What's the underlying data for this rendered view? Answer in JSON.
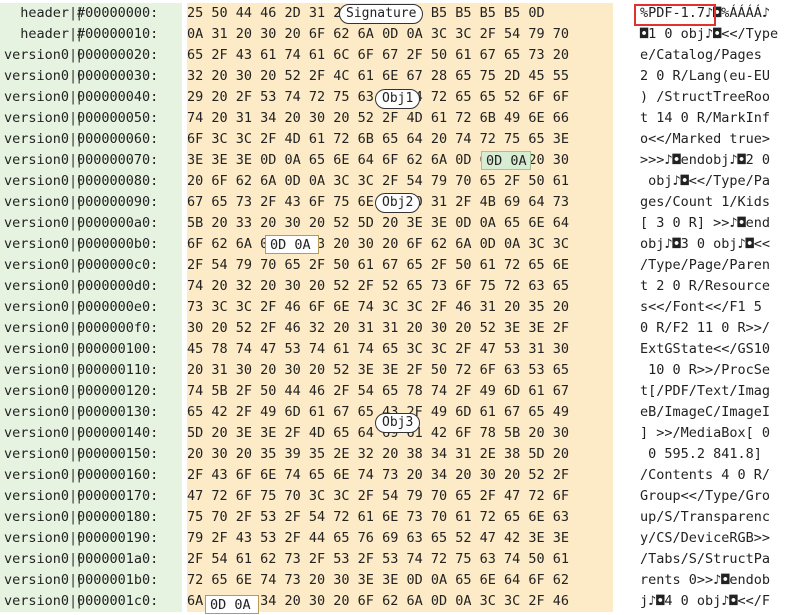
{
  "rows": [
    {
      "label": "header",
      "offset": "#00000000:",
      "hex": "25 50 44 46 2D 31 2E 37 0A 25 B5 B5 B5 B5 0D",
      "ascii": "%PDF-1.7♪◘%ÁÁÁÁ♪"
    },
    {
      "label": "header",
      "offset": "#00000010:",
      "hex": "0A 31 20 30 20 6F 62 6A 0D 0A 3C 3C 2F 54 79 70",
      "ascii": "◘1 0 obj♪◘<</Type"
    },
    {
      "label": "version0",
      "offset": "000000020:",
      "hex": "65 2F 43 61 74 61 6C 6F 67 2F 50 61 67 65 73 20",
      "ascii": "e/Catalog/Pages "
    },
    {
      "label": "version0",
      "offset": "000000030:",
      "hex": "32 20 30 20 52 2F 4C 61 6E 67 28 65 75 2D 45 55",
      "ascii": "2 0 R/Lang(eu-EU"
    },
    {
      "label": "version0",
      "offset": "000000040:",
      "hex": "29 20 2F 53 74 72 75 63 74 54 72 65 65 52 6F 6F",
      "ascii": ") /StructTreeRoo"
    },
    {
      "label": "version0",
      "offset": "000000050:",
      "hex": "74 20 31 34 20 30 20 52 2F 4D 61 72 6B 49 6E 66",
      "ascii": "t 14 0 R/MarkInf"
    },
    {
      "label": "version0",
      "offset": "000000060:",
      "hex": "6F 3C 3C 2F 4D 61 72 6B 65 64 20 74 72 75 65 3E",
      "ascii": "o<</Marked true>"
    },
    {
      "label": "version0",
      "offset": "000000070:",
      "hex": "3E 3E 3E 0D 0A 65 6E 64 6F 62 6A 0D 0A 32 20 30",
      "ascii": ">>>♪◘endobj♪◘2 0"
    },
    {
      "label": "version0",
      "offset": "000000080:",
      "hex": "20 6F 62 6A 0D 0A 3C 3C 2F 54 79 70 65 2F 50 61",
      "ascii": " obj♪◘<</Type/Pa"
    },
    {
      "label": "version0",
      "offset": "000000090:",
      "hex": "67 65 73 2F 43 6F 75 6E 74 20 31 2F 4B 69 64 73",
      "ascii": "ges/Count 1/Kids"
    },
    {
      "label": "version0",
      "offset": "0000000a0:",
      "hex": "5B 20 33 20 30 20 52 5D 20 3E 3E 0D 0A 65 6E 64",
      "ascii": "[ 3 0 R] >>♪◘end"
    },
    {
      "label": "version0",
      "offset": "0000000b0:",
      "hex": "6F 62 6A 0D 0A 33 20 30 20 6F 62 6A 0D 0A 3C 3C",
      "ascii": "obj♪◘3 0 obj♪◘<<"
    },
    {
      "label": "version0",
      "offset": "0000000c0:",
      "hex": "2F 54 79 70 65 2F 50 61 67 65 2F 50 61 72 65 6E",
      "ascii": "/Type/Page/Paren"
    },
    {
      "label": "version0",
      "offset": "0000000d0:",
      "hex": "74 20 32 20 30 20 52 2F 52 65 73 6F 75 72 63 65",
      "ascii": "t 2 0 R/Resource"
    },
    {
      "label": "version0",
      "offset": "0000000e0:",
      "hex": "73 3C 3C 2F 46 6F 6E 74 3C 3C 2F 46 31 20 35 20",
      "ascii": "s<</Font<</F1 5 "
    },
    {
      "label": "version0",
      "offset": "0000000f0:",
      "hex": "30 20 52 2F 46 32 20 31 31 20 30 20 52 3E 3E 2F",
      "ascii": "0 R/F2 11 0 R>>/"
    },
    {
      "label": "version0",
      "offset": "000000100:",
      "hex": "45 78 74 47 53 74 61 74 65 3C 3C 2F 47 53 31 30",
      "ascii": "ExtGState<</GS10"
    },
    {
      "label": "version0",
      "offset": "000000110:",
      "hex": "20 31 30 20 30 20 52 3E 3E 2F 50 72 6F 63 53 65",
      "ascii": " 10 0 R>>/ProcSe"
    },
    {
      "label": "version0",
      "offset": "000000120:",
      "hex": "74 5B 2F 50 44 46 2F 54 65 78 74 2F 49 6D 61 67",
      "ascii": "t[/PDF/Text/Imag"
    },
    {
      "label": "version0",
      "offset": "000000130:",
      "hex": "65 42 2F 49 6D 61 67 65 43 2F 49 6D 61 67 65 49",
      "ascii": "eB/ImageC/ImageI"
    },
    {
      "label": "version0",
      "offset": "000000140:",
      "hex": "5D 20 3E 3E 2F 4D 65 64 69 61 42 6F 78 5B 20 30",
      "ascii": "] >>/MediaBox[ 0"
    },
    {
      "label": "version0",
      "offset": "000000150:",
      "hex": "20 30 20 35 39 35 2E 32 20 38 34 31 2E 38 5D 20",
      "ascii": " 0 595.2 841.8] "
    },
    {
      "label": "version0",
      "offset": "000000160:",
      "hex": "2F 43 6F 6E 74 65 6E 74 73 20 34 20 30 20 52 2F",
      "ascii": "/Contents 4 0 R/"
    },
    {
      "label": "version0",
      "offset": "000000170:",
      "hex": "47 72 6F 75 70 3C 3C 2F 54 79 70 65 2F 47 72 6F",
      "ascii": "Group<</Type/Gro"
    },
    {
      "label": "version0",
      "offset": "000000180:",
      "hex": "75 70 2F 53 2F 54 72 61 6E 73 70 61 72 65 6E 63",
      "ascii": "up/S/Transparenc"
    },
    {
      "label": "version0",
      "offset": "000000190:",
      "hex": "79 2F 43 53 2F 44 65 76 69 63 65 52 47 42 3E 3E",
      "ascii": "y/CS/DeviceRGB>>"
    },
    {
      "label": "version0",
      "offset": "0000001a0:",
      "hex": "2F 54 61 62 73 2F 53 2F 53 74 72 75 63 74 50 61",
      "ascii": "/Tabs/S/StructPa"
    },
    {
      "label": "version0",
      "offset": "0000001b0:",
      "hex": "72 65 6E 74 73 20 30 3E 3E 0D 0A 65 6E 64 6F 62",
      "ascii": "rents 0>>♪◘endob"
    },
    {
      "label": "version0",
      "offset": "0000001c0:",
      "hex": "6A 0D 0A 34 20 30 20 6F 62 6A 0D 0A 3C 3C 2F 46",
      "ascii": "j♪◘4 0 obj♪◘<</F"
    }
  ],
  "annotations": {
    "signature": "Signature",
    "obj1": "Obj1",
    "obj2": "Obj2",
    "obj3": "Obj3",
    "eol_a": "0D 0A",
    "eol_b": "0D 0A",
    "eol_c": "0D 0A"
  },
  "colors": {
    "label_bg": "#e6f3e1",
    "hex_bg": "#fdebc7",
    "highlight_border": "#e03030"
  }
}
